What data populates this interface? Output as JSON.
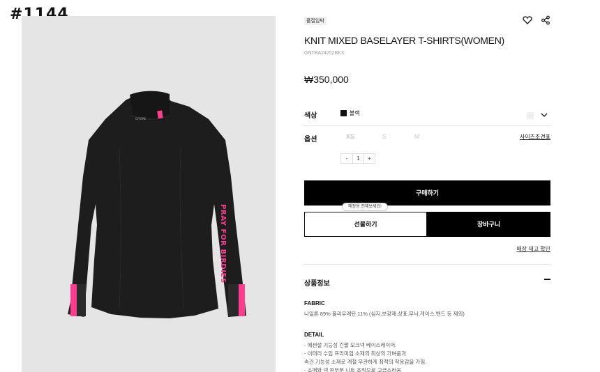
{
  "overlay_label": "#1144",
  "product": {
    "badge": "품절임박",
    "title": "KNIT MIXED BASELAYER T-SHIRTS(WOMEN)",
    "code": "GNTBA24252BKX",
    "price": "₩350,000"
  },
  "icons": {
    "wishlist": "heart-icon",
    "share": "share-icon"
  },
  "color": {
    "label": "색상",
    "selected": "블랙",
    "swatch": "#111111"
  },
  "option": {
    "label": "옵션",
    "sizes": [
      "XS",
      "S",
      "M"
    ],
    "size_chart": "사이즈조견표"
  },
  "quantity": {
    "minus": "-",
    "value": "1",
    "plus": "+"
  },
  "buttons": {
    "buy": "구매하기",
    "gift": "선물하기",
    "cart": "장바구니",
    "gift_tooltip": "매장용 전체보세요!"
  },
  "store_check": "매장 재고 확인",
  "info": {
    "title": "상품정보",
    "fabric_head": "FABRIC",
    "fabric_text": "나일론 89% 폴리우레탄 11% (심지,보강재,상표,무늬,게이스,밴드 등 제외)",
    "detail_head": "DETAIL",
    "detail_lines": [
      "- 에센셜 기능성 긴팔 모크넥 베이스레이어.",
      "- 이태리 수입 프리미엄 소재의 최상의 가벼움과",
      "  속건 기능성 소재로 계절 무관하게 최적의 착용감을 가짐.",
      "- 소매와 넥 원부분 니트 조직으로 고급스러움"
    ]
  },
  "image_text": {
    "sleeve_print": "PRAY FOR BIRDIES",
    "collar_logo": "G/FORE"
  },
  "colors": {
    "accent_pink": "#ff3c8e",
    "garment": "#1a1a1a",
    "panel_bg": "#e5e5e5"
  }
}
